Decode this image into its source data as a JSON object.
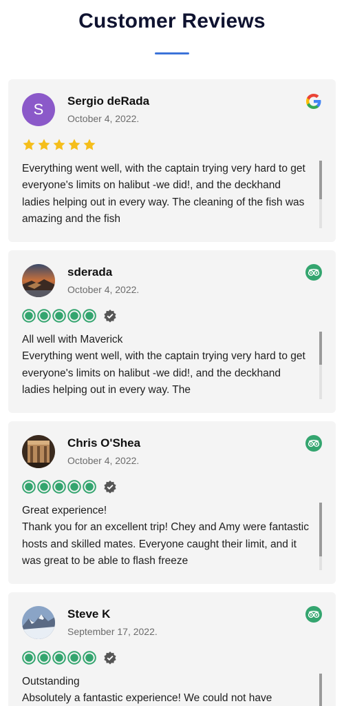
{
  "page": {
    "title": "Customer Reviews",
    "accent_color": "#3b73d9"
  },
  "reviews": [
    {
      "avatar_letter": "S",
      "avatar_color": "#8b59c9",
      "name": "Sergio deRada",
      "date": "October 4, 2022.",
      "source_icon": "google-icon",
      "rating": 5,
      "rating_style": "stars",
      "headline": "",
      "text": "Everything went well, with the captain trying very hard to get everyone's limits on halibut -we did!, and the deckhand ladies helping out in every way. The cleaning of the fish was amazing and the fish"
    },
    {
      "avatar_icon": "avatar-photo-sunset-coast",
      "name": "sderada",
      "date": "October 4, 2022.",
      "source_icon": "tripadvisor-icon",
      "rating": 5,
      "rating_style": "bubbles",
      "headline": "All well with Maverick",
      "text": "Everything went well, with the captain trying very hard to get everyone's limits on halibut -we did!, and the deckhand ladies helping out in every way. The"
    },
    {
      "avatar_icon": "avatar-photo-building",
      "name": "Chris O'Shea",
      "date": "October 4, 2022.",
      "source_icon": "tripadvisor-icon",
      "rating": 5,
      "rating_style": "bubbles",
      "headline": "Great experience!",
      "text": "Thank you for an excellent trip! Chey and Amy were fantastic hosts and skilled mates. Everyone caught their limit, and it was great to be able to flash freeze"
    },
    {
      "avatar_icon": "avatar-photo-mountains",
      "name": "Steve K",
      "date": "September 17, 2022.",
      "source_icon": "tripadvisor-icon",
      "rating": 5,
      "rating_style": "bubbles",
      "headline": "Outstanding",
      "text": "Absolutely a fantastic experience! We could not have"
    }
  ],
  "colors": {
    "star": "#f5be1b",
    "tripadvisor_green": "#34a56f",
    "verified_gray": "#555555",
    "card_bg": "#f4f4f4"
  }
}
